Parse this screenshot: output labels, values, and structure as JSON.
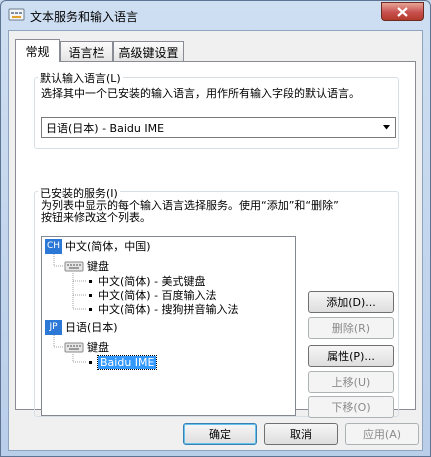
{
  "window": {
    "title": "文本服务和输入语言"
  },
  "tabs": [
    {
      "label": "常规",
      "active": true
    },
    {
      "label": "语言栏",
      "active": false
    },
    {
      "label": "高级键设置",
      "active": false
    }
  ],
  "default_language": {
    "legend": "默认输入语言(L)",
    "description": "选择其中一个已安装的输入语言，用作所有输入字段的默认语言。",
    "selected": "日语(日本) - Baidu IME"
  },
  "installed_services": {
    "legend": "已安装的服务(I)",
    "description_line1": "为列表中显示的每个输入语言选择服务。使用“添加”和“删除”",
    "description_line2": "按钮来修改这个列表。",
    "tree": [
      {
        "badge": "CH",
        "label": "中文(简体，中国)",
        "group": "键盘",
        "items": [
          "中文(简体) - 美式键盘",
          "中文(简体) - 百度输入法",
          "中文(简体) - 搜狗拼音输入法"
        ]
      },
      {
        "badge": "JP",
        "label": "日语(日本)",
        "group": "键盘",
        "items": [
          "Baidu IME"
        ]
      }
    ],
    "buttons": {
      "add": "添加(D)...",
      "remove": "删除(R)",
      "properties": "属性(P)...",
      "move_up": "上移(U)",
      "move_down": "下移(O)"
    }
  },
  "footer": {
    "ok": "确定",
    "cancel": "取消",
    "apply": "应用(A)"
  }
}
